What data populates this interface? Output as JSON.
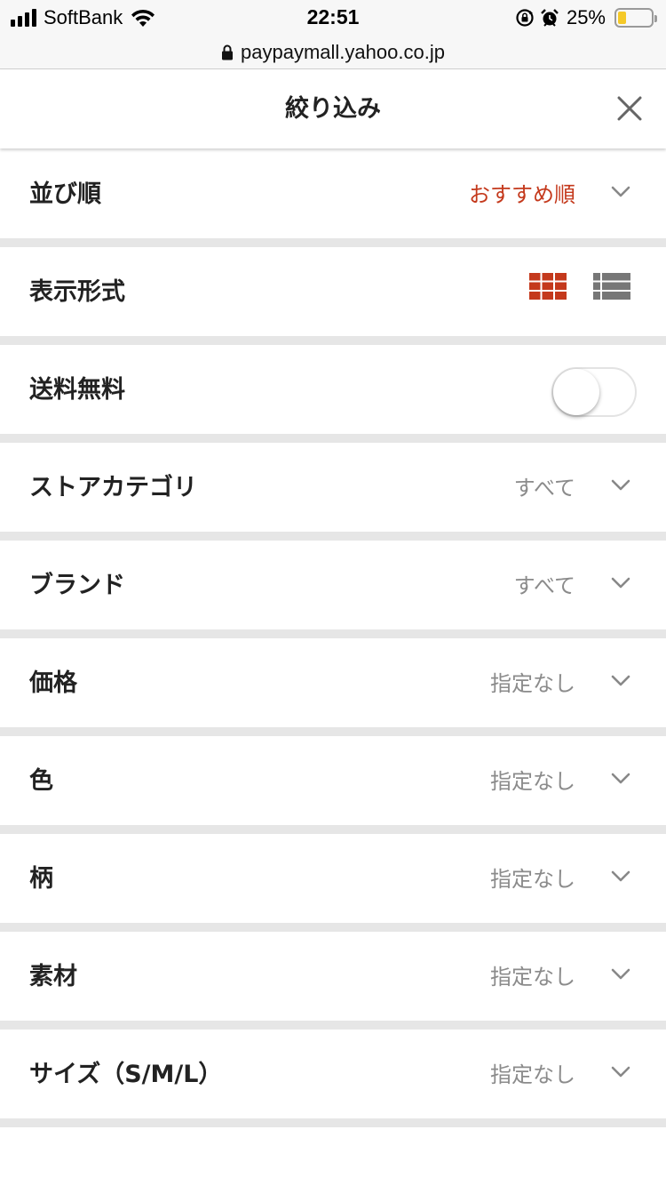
{
  "status_bar": {
    "carrier": "SoftBank",
    "time": "22:51",
    "battery_percent": "25%",
    "battery_level": 0.25,
    "battery_color": "#f5c928",
    "icons": [
      "signal-icon",
      "wifi-icon",
      "rotation-lock-icon",
      "alarm-icon",
      "battery-icon"
    ]
  },
  "browser": {
    "url": "paypaymall.yahoo.co.jp",
    "icons": [
      "lock-icon"
    ]
  },
  "header": {
    "title": "絞り込み",
    "close_icon": "close-icon"
  },
  "accent_color": "#c4391c",
  "filters": {
    "sort": {
      "label": "並び順",
      "value": "おすすめ順"
    },
    "display": {
      "label": "表示形式",
      "selected": "grid",
      "icons": [
        "grid-view-icon",
        "list-view-icon"
      ]
    },
    "free_shipping": {
      "label": "送料無料",
      "enabled": false
    },
    "store_category": {
      "label": "ストアカテゴリ",
      "value": "すべて"
    },
    "brand": {
      "label": "ブランド",
      "value": "すべて"
    },
    "price": {
      "label": "価格",
      "value": "指定なし"
    },
    "color": {
      "label": "色",
      "value": "指定なし"
    },
    "pattern": {
      "label": "柄",
      "value": "指定なし"
    },
    "material": {
      "label": "素材",
      "value": "指定なし"
    },
    "size": {
      "label": "サイズ（S/M/L）",
      "value": "指定なし"
    }
  }
}
